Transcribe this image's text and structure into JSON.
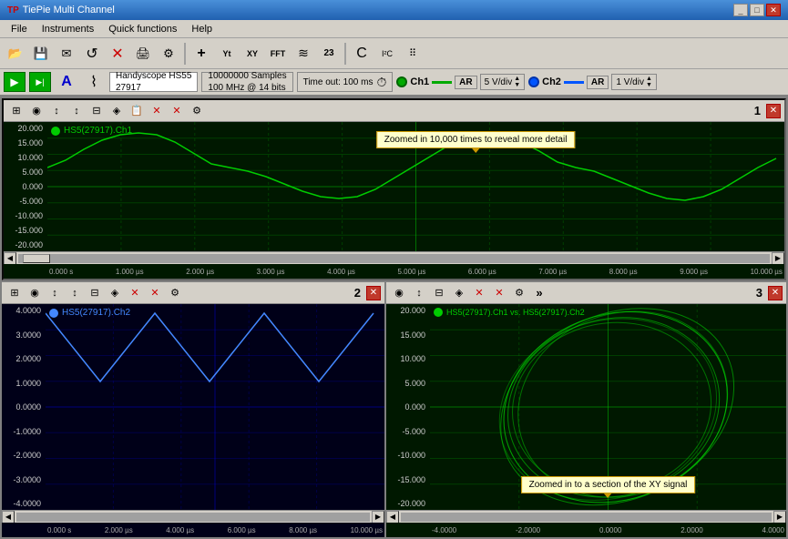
{
  "titleBar": {
    "title": "TiePie Multi Channel",
    "minimizeLabel": "_",
    "maximizeLabel": "□",
    "closeLabel": "✕"
  },
  "menuBar": {
    "items": [
      "File",
      "Instruments",
      "Quick functions",
      "Help"
    ]
  },
  "toolbar": {
    "buttons": [
      {
        "name": "open-folder",
        "icon": "📂"
      },
      {
        "name": "save",
        "icon": "💾"
      },
      {
        "name": "email",
        "icon": "✉"
      },
      {
        "name": "refresh",
        "icon": "↺"
      },
      {
        "name": "cut",
        "icon": "✂"
      },
      {
        "name": "print",
        "icon": "🖨"
      },
      {
        "name": "settings",
        "icon": "⚙"
      },
      {
        "name": "add-cursor",
        "icon": "+"
      },
      {
        "name": "waveform",
        "icon": "∿"
      },
      {
        "name": "xy-mode",
        "icon": "XY"
      },
      {
        "name": "fft",
        "icon": "FFT"
      },
      {
        "name": "measure",
        "icon": "≋"
      },
      {
        "name": "counter",
        "icon": "23"
      },
      {
        "name": "c-icon",
        "icon": "C"
      },
      {
        "name": "i2c",
        "icon": "I²C"
      },
      {
        "name": "serial",
        "icon": "⠿"
      }
    ]
  },
  "channelBar": {
    "playLabel": "▶",
    "play2Label": "▶|",
    "aLabel": "A",
    "waveLabel": "⌇",
    "deviceName": "Handyscope HS55",
    "deviceId": "27917",
    "samples": "10000000 Samples",
    "freq": "100 MHz @ 14 bits",
    "timeout": "Time out: 100 ms",
    "ch1": {
      "label": "Ch1",
      "color": "#00aa00",
      "lineColor": "#00aa00",
      "arLabel": "AR",
      "divLabel": "5 V/div"
    },
    "ch2": {
      "label": "Ch2",
      "color": "#0055ff",
      "lineColor": "#0055ff",
      "arLabel": "AR",
      "divLabel": "1 V/div"
    }
  },
  "panel1": {
    "number": "1",
    "channelLabel": "HS5(27917).Ch1",
    "callout": "Zoomed in 10,000 times to reveal more detail",
    "yLabels": [
      "20.000",
      "15.000",
      "10.000",
      "5.000",
      "0.000",
      "-5.000",
      "-10.000",
      "-15.000",
      "-20.000"
    ],
    "xLabels": [
      "0.000 s",
      "1.000 µs",
      "2.000 µs",
      "3.000 µs",
      "4.000 µs",
      "5.000 µs",
      "6.000 µs",
      "7.000 µs",
      "8.000 µs",
      "9.000 µs",
      "10.000 µs"
    ]
  },
  "panel2": {
    "number": "2",
    "channelLabel": "HS5(27917).Ch2",
    "yLabels": [
      "4.0000",
      "3.0000",
      "2.0000",
      "1.0000",
      "0.0000",
      "-1.0000",
      "-2.0000",
      "-3.0000",
      "-4.0000"
    ],
    "xLabels": [
      "0.000 s",
      "2.000 µs",
      "4.000 µs",
      "6.000 µs",
      "8.000 µs",
      "10.000 µs"
    ]
  },
  "panel3": {
    "number": "3",
    "channelLabel": "HS5(27917).Ch1 vs. HS5(27917).Ch2",
    "callout": "Zoomed in to a section of the XY signal",
    "yLabels": [
      "20.000",
      "15.000",
      "10.000",
      "5.000",
      "0.000",
      "-5.000",
      "-10.000",
      "-15.000",
      "-20.000"
    ],
    "xLabels": [
      "-4.0000",
      "-2.0000",
      "0.0000",
      "2.0000",
      "4.0000"
    ]
  }
}
